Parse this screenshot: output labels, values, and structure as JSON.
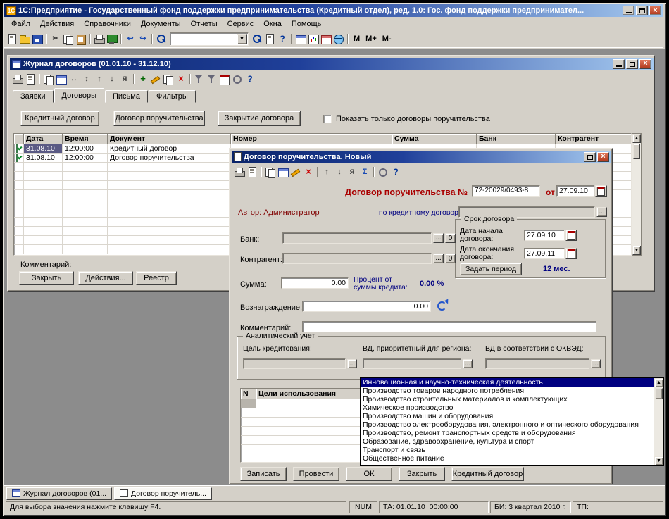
{
  "app": {
    "title": "1С:Предприятие - Государственный фонд поддержки предпринимательства (Кредитный отдел), ред. 1.0: Гос. фонд поддержки предпринимател...",
    "menu": [
      "Файл",
      "Действия",
      "Справочники",
      "Документы",
      "Отчеты",
      "Сервис",
      "Окна",
      "Помощь"
    ],
    "toolbar": {
      "m": "М",
      "m_plus": "М+",
      "m_minus": "М-"
    }
  },
  "journal": {
    "title": "Журнал договоров (01.01.10 - 31.12.10)",
    "tabs": [
      "Заявки",
      "Договоры",
      "Письма",
      "Фильтры"
    ],
    "buttons": {
      "credit": "Кредитный договор",
      "surety": "Договор поручительства",
      "close_doc": "Закрытие договора"
    },
    "checkbox_label": "Показать только договоры поручительства",
    "table": {
      "columns": [
        "Дата",
        "Время",
        "Документ",
        "Номер",
        "Сумма",
        "Банк",
        "Контрагент"
      ],
      "rows": [
        {
          "date": "31.08.10",
          "time": "12:00:00",
          "doc": "Кредитный договор"
        },
        {
          "date": "31.08.10",
          "time": "12:00:00",
          "doc": "Договор поручительства"
        }
      ]
    },
    "comment_label": "Комментарий:",
    "footer": {
      "close": "Закрыть",
      "actions": "Действия...",
      "registry": "Реестр"
    }
  },
  "dialog": {
    "title": "Договор поручительства. Новый",
    "heading": "Договор поручительства №",
    "number": "72-20029/0493-8",
    "from_label": "от",
    "date": "27.09.10",
    "author": "Автор: Администратор",
    "by_credit_label": "по кредитному договору:",
    "term": {
      "title": "Срок договора",
      "start_label": "Дата начала договора:",
      "start": "27.09.10",
      "end_label": "Дата окончания договора:",
      "end": "27.09.11",
      "set_period": "Задать период",
      "duration": "12 мес."
    },
    "bank_label": "Банк:",
    "bank_counter": "0",
    "contractor_label": "Контрагент:",
    "contractor_counter": "0",
    "sum_label": "Сумма:",
    "sum": "0.00",
    "percent_label": "Процент от суммы кредита:",
    "percent": "0.00 %",
    "reward_label": "Вознаграждение:",
    "reward": "0.00",
    "comment_label": "Комментарий:",
    "analytics": {
      "title": "Аналитический учет",
      "goal_label": "Цель кредитования:",
      "priority_label": "ВД, приоритетный для региона:",
      "okved_label": "ВД в соответствии с ОКВЭД:"
    },
    "usage_columns": [
      "N",
      "Цели использования"
    ],
    "footer": {
      "save": "Записать",
      "post": "Провести",
      "ok": "ОК",
      "close": "Закрыть",
      "credit": "Кредитный договор"
    }
  },
  "dropdown": {
    "items": [
      "Инновационная и научно-техническая деятельность",
      "Производство товаров народного потребления",
      "Производство строительных материалов и комплектующих",
      "Химическое производство",
      "Производство машин и оборудования",
      "Производство электрооборудования, электронного и оптического оборудования",
      "Производство, ремонт транспортных средств и оборудования",
      "Образование, здравоохранение, культура и спорт",
      "Транспорт и связь",
      "Общественное питание"
    ]
  },
  "window_tabs": {
    "journal": "Журнал договоров (01...",
    "dialog": "Договор поручитель..."
  },
  "status": {
    "hint": "Для выбора значения нажмите клавишу F4.",
    "num": "NUM",
    "ta": "ТА: 01.01.10  00:00:00",
    "bi": "БИ: 3 квартал 2010 г.",
    "tp": "ТП:"
  },
  "misc": {
    "ellipsis": "..."
  }
}
